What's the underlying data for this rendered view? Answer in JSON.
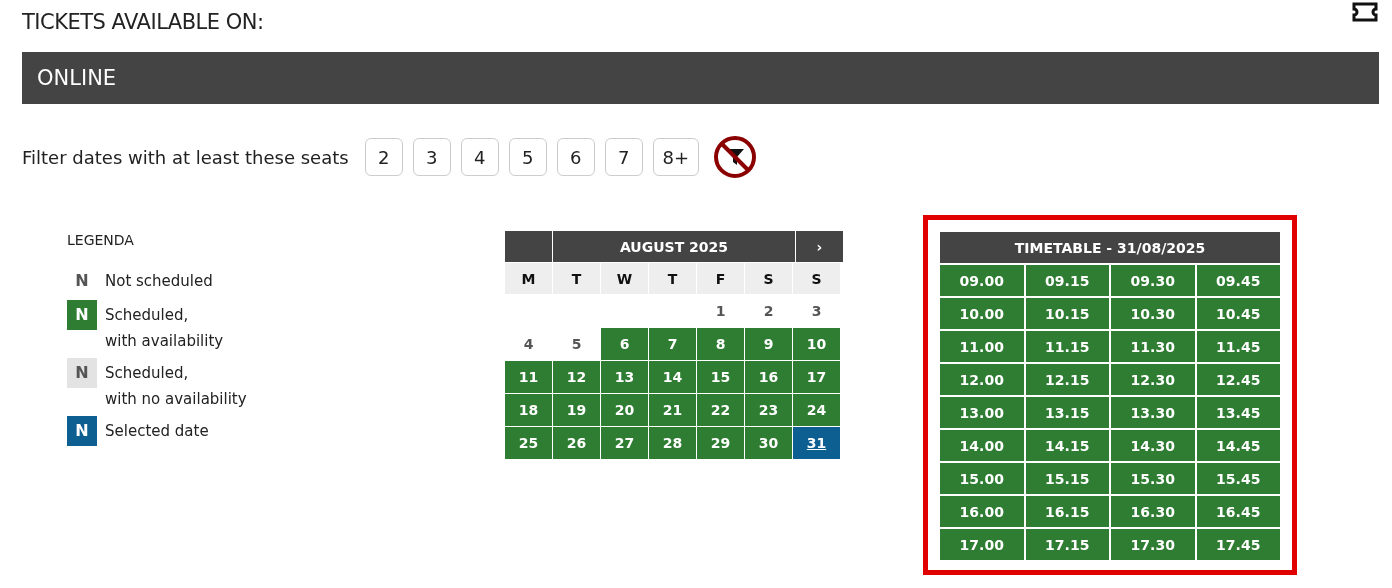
{
  "title": "TICKETS AVAILABLE ON:",
  "channel_bar": {
    "label": "ONLINE"
  },
  "seat_filter": {
    "label": "Filter dates with at least these seats",
    "options": [
      {
        "label": "2",
        "selected": false
      },
      {
        "label": "3",
        "selected": false
      },
      {
        "label": "4",
        "selected": false
      },
      {
        "label": "5",
        "selected": false
      },
      {
        "label": "6",
        "selected": false
      },
      {
        "label": "7",
        "selected": false
      },
      {
        "label": "8+",
        "selected": false
      }
    ]
  },
  "legend": {
    "title": "LEGENDA",
    "items": [
      {
        "kind": "none",
        "symbol": "N",
        "lines": [
          "Not scheduled"
        ]
      },
      {
        "kind": "available",
        "symbol": "N",
        "lines": [
          "Scheduled,",
          "with availability"
        ]
      },
      {
        "kind": "full",
        "symbol": "N",
        "lines": [
          "Scheduled,",
          "with no availability"
        ]
      },
      {
        "kind": "selected",
        "symbol": "N",
        "lines": [
          "Selected date"
        ]
      }
    ]
  },
  "calendar": {
    "month": "AUGUST 2025",
    "next": "›",
    "weekdays": [
      "M",
      "T",
      "W",
      "T",
      "F",
      "S",
      "S"
    ],
    "weeks": [
      {
        "days": [
          {
            "day": "1",
            "kind": "none"
          },
          {
            "day": "2",
            "kind": "none"
          },
          {
            "day": "3",
            "kind": "none"
          }
        ]
      },
      {
        "days": [
          {
            "day": "4",
            "kind": "none"
          },
          {
            "day": "5",
            "kind": "none"
          },
          {
            "day": "6",
            "kind": "available"
          },
          {
            "day": "7",
            "kind": "available"
          },
          {
            "day": "8",
            "kind": "available"
          },
          {
            "day": "9",
            "kind": "available"
          },
          {
            "day": "10",
            "kind": "available"
          }
        ]
      },
      {
        "days": [
          {
            "day": "11",
            "kind": "available"
          },
          {
            "day": "12",
            "kind": "available"
          },
          {
            "day": "13",
            "kind": "available"
          },
          {
            "day": "14",
            "kind": "available"
          },
          {
            "day": "15",
            "kind": "available"
          },
          {
            "day": "16",
            "kind": "available"
          },
          {
            "day": "17",
            "kind": "available"
          }
        ]
      },
      {
        "days": [
          {
            "day": "18",
            "kind": "available"
          },
          {
            "day": "19",
            "kind": "available"
          },
          {
            "day": "20",
            "kind": "available"
          },
          {
            "day": "21",
            "kind": "available"
          },
          {
            "day": "22",
            "kind": "available"
          },
          {
            "day": "23",
            "kind": "available"
          },
          {
            "day": "24",
            "kind": "available"
          }
        ]
      },
      {
        "days": [
          {
            "day": "25",
            "kind": "available"
          },
          {
            "day": "26",
            "kind": "available"
          },
          {
            "day": "27",
            "kind": "available"
          },
          {
            "day": "28",
            "kind": "available"
          },
          {
            "day": "29",
            "kind": "available"
          },
          {
            "day": "30",
            "kind": "available"
          },
          {
            "day": "31",
            "kind": "selected"
          }
        ]
      }
    ]
  },
  "timetable": {
    "title": "TIMETABLE - 31/08/2025",
    "highlighted": true,
    "rows": [
      [
        "09.00",
        "09.15",
        "09.30",
        "09.45"
      ],
      [
        "10.00",
        "10.15",
        "10.30",
        "10.45"
      ],
      [
        "11.00",
        "11.15",
        "11.30",
        "11.45"
      ],
      [
        "12.00",
        "12.15",
        "12.30",
        "12.45"
      ],
      [
        "13.00",
        "13.15",
        "13.30",
        "13.45"
      ],
      [
        "14.00",
        "14.15",
        "14.30",
        "14.45"
      ],
      [
        "15.00",
        "15.15",
        "15.30",
        "15.45"
      ],
      [
        "16.00",
        "16.15",
        "16.30",
        "16.45"
      ],
      [
        "17.00",
        "17.15",
        "17.30",
        "17.45"
      ]
    ]
  }
}
